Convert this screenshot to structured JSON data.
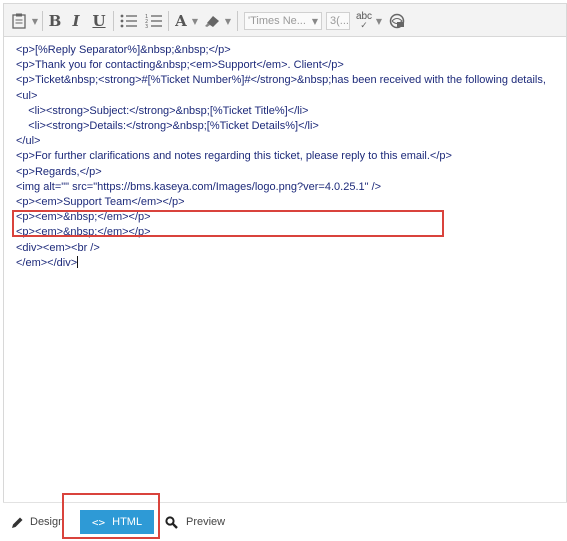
{
  "toolbar": {
    "bold": "B",
    "italic": "I",
    "underline": "U",
    "font_color": "A",
    "font_name": "'Times Ne...",
    "font_size": "3(...",
    "spellcheck": "abc"
  },
  "editor": {
    "lines": [
      "<p>[%Reply Separator%]&nbsp;&nbsp;</p>",
      "<p>Thank you for contacting&nbsp;<em>Support</em>. Client</p>",
      "<p>Ticket&nbsp;<strong>#[%Ticket Number%]#</strong>&nbsp;has been received with the following details,",
      "<ul>",
      "    <li><strong>Subject:</strong>&nbsp;[%Ticket Title%]</li>",
      "    <li><strong>Details:</strong>&nbsp;[%Ticket Details%]</li>",
      "</ul>",
      "<p>For further clarifications and notes regarding this ticket, please reply to this email.</p>",
      "<p>Regards,</p>",
      "<img alt=\"\" src=\"https://bms.kaseya.com/Images/logo.png?ver=4.0.25.1\" />",
      "<p><em>Support Team</em></p>",
      "<p><em>&nbsp;</em></p>",
      "<p><em>&nbsp;</em></p>",
      "<div><em><br />",
      "</em></div>"
    ]
  },
  "modes": {
    "design": "Design",
    "html": "HTML",
    "preview": "Preview"
  }
}
